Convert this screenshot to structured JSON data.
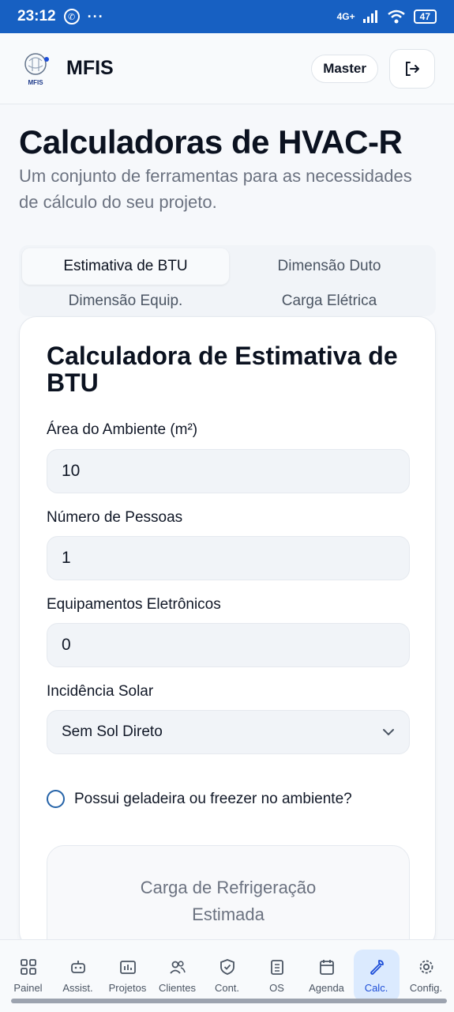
{
  "status_bar": {
    "time": "23:12",
    "dots": "···",
    "network": "4G+",
    "battery": "47"
  },
  "header": {
    "app_name": "MFIS",
    "logo_text": "MFIS",
    "role_badge": "Master"
  },
  "page": {
    "title": "Calculadoras de HVAC-R",
    "subtitle": "Um conjunto de ferramentas para as necessidades de cálculo do seu projeto."
  },
  "tabs": [
    {
      "label": "Estimativa de BTU",
      "active": true
    },
    {
      "label": "Dimensão Duto",
      "active": false
    },
    {
      "label": "Dimensão Equip.",
      "active": false
    },
    {
      "label": "Carga Elétrica",
      "active": false
    }
  ],
  "card": {
    "title": "Calculadora de Estimativa de BTU",
    "fields": [
      {
        "label": "Área do Ambiente (m²)",
        "value": "10"
      },
      {
        "label": "Número de Pessoas",
        "value": "1"
      },
      {
        "label": "Equipamentos Eletrônicos",
        "value": "0"
      }
    ],
    "solar": {
      "label": "Incidência Solar",
      "value": "Sem Sol Direto"
    },
    "fridge_check": {
      "label": "Possui geladeira ou freezer no ambiente?",
      "checked": false
    },
    "result_label": "Carga de Refrigeração Estimada"
  },
  "bottom_nav": [
    {
      "label": "Painel",
      "icon": "grid-icon"
    },
    {
      "label": "Assist.",
      "icon": "bot-icon"
    },
    {
      "label": "Projetos",
      "icon": "folder-chart-icon"
    },
    {
      "label": "Clientes",
      "icon": "users-icon"
    },
    {
      "label": "Cont.",
      "icon": "shield-check-icon"
    },
    {
      "label": "OS",
      "icon": "clipboard-list-icon"
    },
    {
      "label": "Agenda",
      "icon": "calendar-icon"
    },
    {
      "label": "Calc.",
      "icon": "wrench-icon",
      "active": true
    },
    {
      "label": "Config.",
      "icon": "gear-icon"
    }
  ],
  "colors": {
    "status_bar": "#1760c2",
    "accent": "#1d4ed8",
    "active_nav_bg": "#dbeafe"
  }
}
